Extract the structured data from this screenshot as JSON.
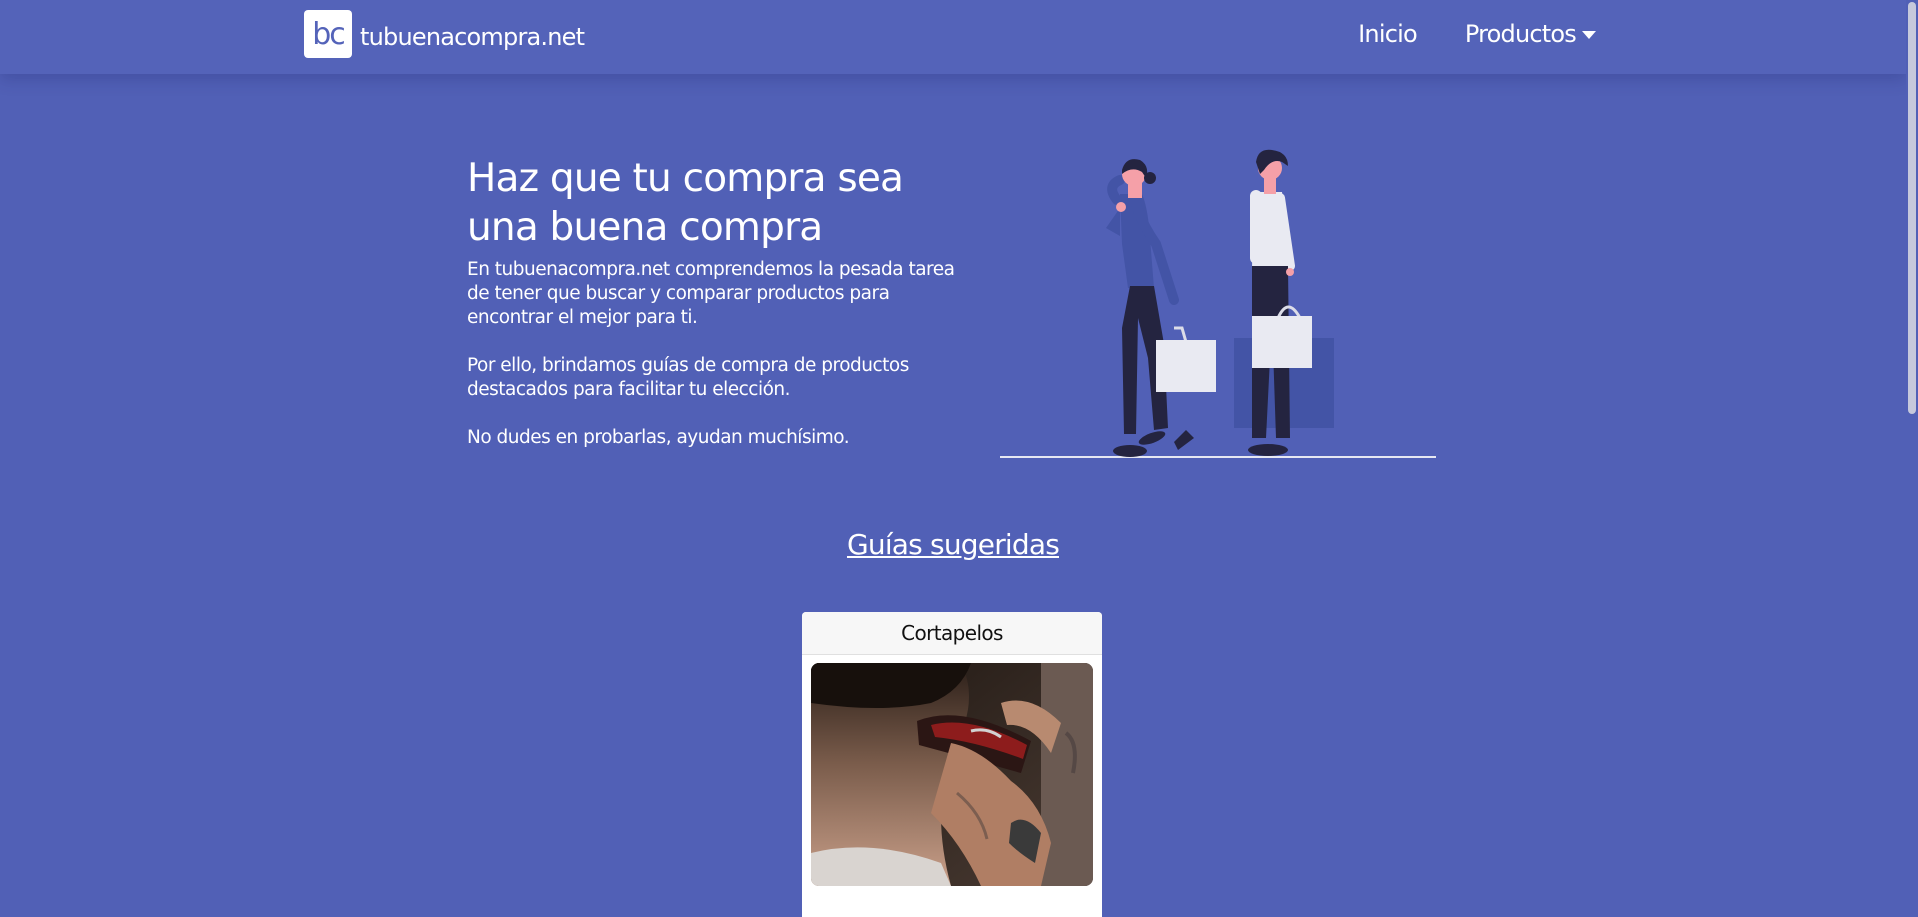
{
  "nav": {
    "logo_text": "bc",
    "brand_name": "tubuenacompra.net",
    "links": [
      {
        "label": "Inicio"
      },
      {
        "label": "Productos"
      }
    ]
  },
  "hero": {
    "title": "Haz que tu compra sea una buena compra",
    "paragraphs": [
      "En tubuenacompra.net comprendemos la pesada tarea de tener que buscar y comparar productos para encontrar el mejor para ti.",
      "Por ello, brindamos guías de compra de productos destacados para facilitar tu elección.",
      "No dudes en probarlas, ayudan muchísimo."
    ]
  },
  "suggested": {
    "title": "Guías sugeridas",
    "cards": [
      {
        "title": "Cortapelos"
      }
    ]
  },
  "colors": {
    "background": "#5160b6",
    "navbar": "#5463b9",
    "card": "#ffffff"
  }
}
